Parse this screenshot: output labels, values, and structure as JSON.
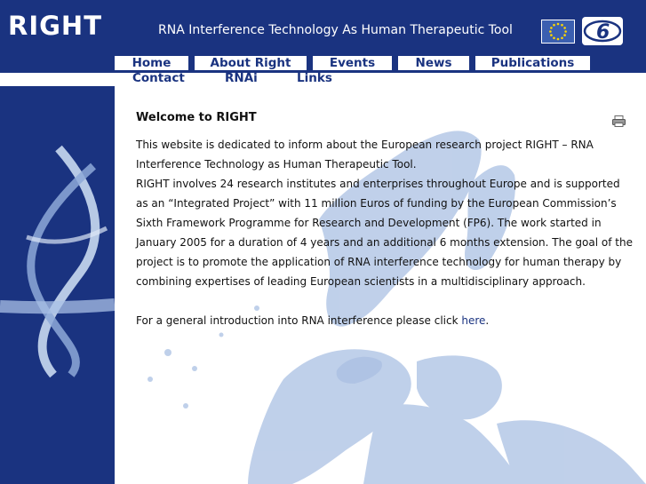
{
  "header": {
    "logo_text": "RIGHT",
    "site_title": "RNA Interference Technology As Human Therapeutic Tool",
    "eu_flag_icon": "eu-flag-icon",
    "fp6_logo_icon": "fp6-logo-icon"
  },
  "nav": {
    "row1": [
      "Home",
      "About Right",
      "Events",
      "News",
      "Publications"
    ],
    "row2": [
      "Contact",
      "RNAi",
      "Links"
    ]
  },
  "content": {
    "heading": "Welcome to RIGHT",
    "print_icon": "printer-icon",
    "paragraph1a": "This website is dedicated to inform about the European research project RIGHT – RNA Interference Technology as Human Therapeutic Tool.",
    "paragraph1b": "RIGHT involves 24 research institutes and enterprises throughout Europe and is supported as an “Integrated Project” with 11 million Euros of funding by the European Commission’s Sixth Framework Programme for Research and Development (FP6). The work started in January 2005 for a duration of 4 years and an additional 6 months extension. The goal of the project is to promote the application of RNA interference technology for human therapy by combining expertises of leading European scientists in a multidisciplinary approach.",
    "intro_prefix": "For a general introduction into RNA interference please click ",
    "intro_link": "here",
    "intro_suffix": "."
  },
  "colors": {
    "brand_blue": "#1a3380",
    "map_blue": "#b9cbe8"
  }
}
